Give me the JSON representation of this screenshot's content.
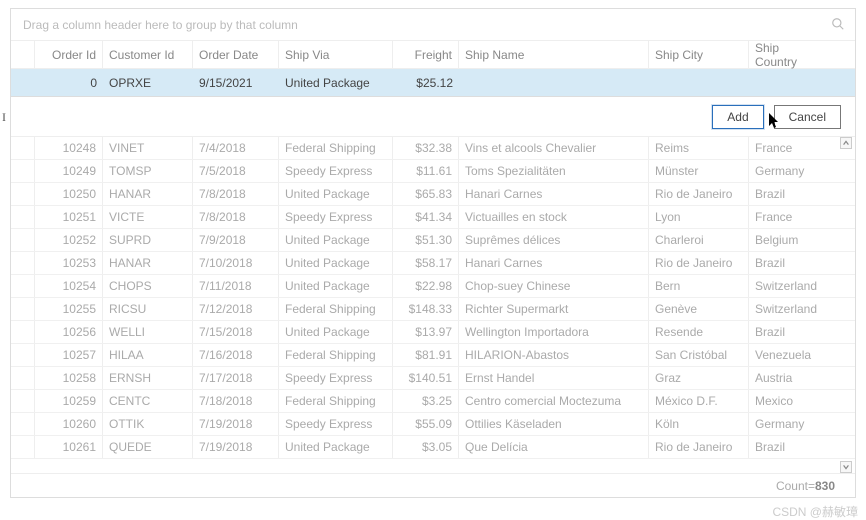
{
  "group_panel": {
    "hint": "Drag a column header here to group by that column"
  },
  "columns": {
    "orderid": "Order Id",
    "customerid": "Customer Id",
    "orderdate": "Order Date",
    "shipvia": "Ship Via",
    "freight": "Freight",
    "shipname": "Ship Name",
    "shipcity": "Ship City",
    "shipcountry": "Ship Country"
  },
  "new_row": {
    "orderid": "0",
    "customerid": "OPRXE",
    "orderdate": "9/15/2021",
    "shipvia": "United Package",
    "freight": "$25.12",
    "shipname": "",
    "shipcity": "",
    "shipcountry": ""
  },
  "buttons": {
    "add": "Add",
    "cancel": "Cancel"
  },
  "rows": [
    {
      "orderid": "10248",
      "customerid": "VINET",
      "orderdate": "7/4/2018",
      "shipvia": "Federal Shipping",
      "freight": "$32.38",
      "shipname": "Vins et alcools Chevalier",
      "shipcity": "Reims",
      "shipcountry": "France"
    },
    {
      "orderid": "10249",
      "customerid": "TOMSP",
      "orderdate": "7/5/2018",
      "shipvia": "Speedy Express",
      "freight": "$11.61",
      "shipname": "Toms Spezialitäten",
      "shipcity": "Münster",
      "shipcountry": "Germany"
    },
    {
      "orderid": "10250",
      "customerid": "HANAR",
      "orderdate": "7/8/2018",
      "shipvia": "United Package",
      "freight": "$65.83",
      "shipname": "Hanari Carnes",
      "shipcity": "Rio de Janeiro",
      "shipcountry": "Brazil"
    },
    {
      "orderid": "10251",
      "customerid": "VICTE",
      "orderdate": "7/8/2018",
      "shipvia": "Speedy Express",
      "freight": "$41.34",
      "shipname": "Victuailles en stock",
      "shipcity": "Lyon",
      "shipcountry": "France"
    },
    {
      "orderid": "10252",
      "customerid": "SUPRD",
      "orderdate": "7/9/2018",
      "shipvia": "United Package",
      "freight": "$51.30",
      "shipname": "Suprêmes délices",
      "shipcity": "Charleroi",
      "shipcountry": "Belgium"
    },
    {
      "orderid": "10253",
      "customerid": "HANAR",
      "orderdate": "7/10/2018",
      "shipvia": "United Package",
      "freight": "$58.17",
      "shipname": "Hanari Carnes",
      "shipcity": "Rio de Janeiro",
      "shipcountry": "Brazil"
    },
    {
      "orderid": "10254",
      "customerid": "CHOPS",
      "orderdate": "7/11/2018",
      "shipvia": "United Package",
      "freight": "$22.98",
      "shipname": "Chop-suey Chinese",
      "shipcity": "Bern",
      "shipcountry": "Switzerland"
    },
    {
      "orderid": "10255",
      "customerid": "RICSU",
      "orderdate": "7/12/2018",
      "shipvia": "Federal Shipping",
      "freight": "$148.33",
      "shipname": "Richter Supermarkt",
      "shipcity": "Genève",
      "shipcountry": "Switzerland"
    },
    {
      "orderid": "10256",
      "customerid": "WELLI",
      "orderdate": "7/15/2018",
      "shipvia": "United Package",
      "freight": "$13.97",
      "shipname": "Wellington Importadora",
      "shipcity": "Resende",
      "shipcountry": "Brazil"
    },
    {
      "orderid": "10257",
      "customerid": "HILAA",
      "orderdate": "7/16/2018",
      "shipvia": "Federal Shipping",
      "freight": "$81.91",
      "shipname": "HILARION-Abastos",
      "shipcity": "San Cristóbal",
      "shipcountry": "Venezuela"
    },
    {
      "orderid": "10258",
      "customerid": "ERNSH",
      "orderdate": "7/17/2018",
      "shipvia": "Speedy Express",
      "freight": "$140.51",
      "shipname": "Ernst Handel",
      "shipcity": "Graz",
      "shipcountry": "Austria"
    },
    {
      "orderid": "10259",
      "customerid": "CENTC",
      "orderdate": "7/18/2018",
      "shipvia": "Federal Shipping",
      "freight": "$3.25",
      "shipname": "Centro comercial Moctezuma",
      "shipcity": "México D.F.",
      "shipcountry": "Mexico"
    },
    {
      "orderid": "10260",
      "customerid": "OTTIK",
      "orderdate": "7/19/2018",
      "shipvia": "Speedy Express",
      "freight": "$55.09",
      "shipname": "Ottilies Käseladen",
      "shipcity": "Köln",
      "shipcountry": "Germany"
    },
    {
      "orderid": "10261",
      "customerid": "QUEDE",
      "orderdate": "7/19/2018",
      "shipvia": "United Package",
      "freight": "$3.05",
      "shipname": "Que Delícia",
      "shipcity": "Rio de Janeiro",
      "shipcountry": "Brazil"
    }
  ],
  "footer": {
    "count_label": "Count=",
    "count_value": "830"
  },
  "watermark": "CSDN @赫敏璋"
}
